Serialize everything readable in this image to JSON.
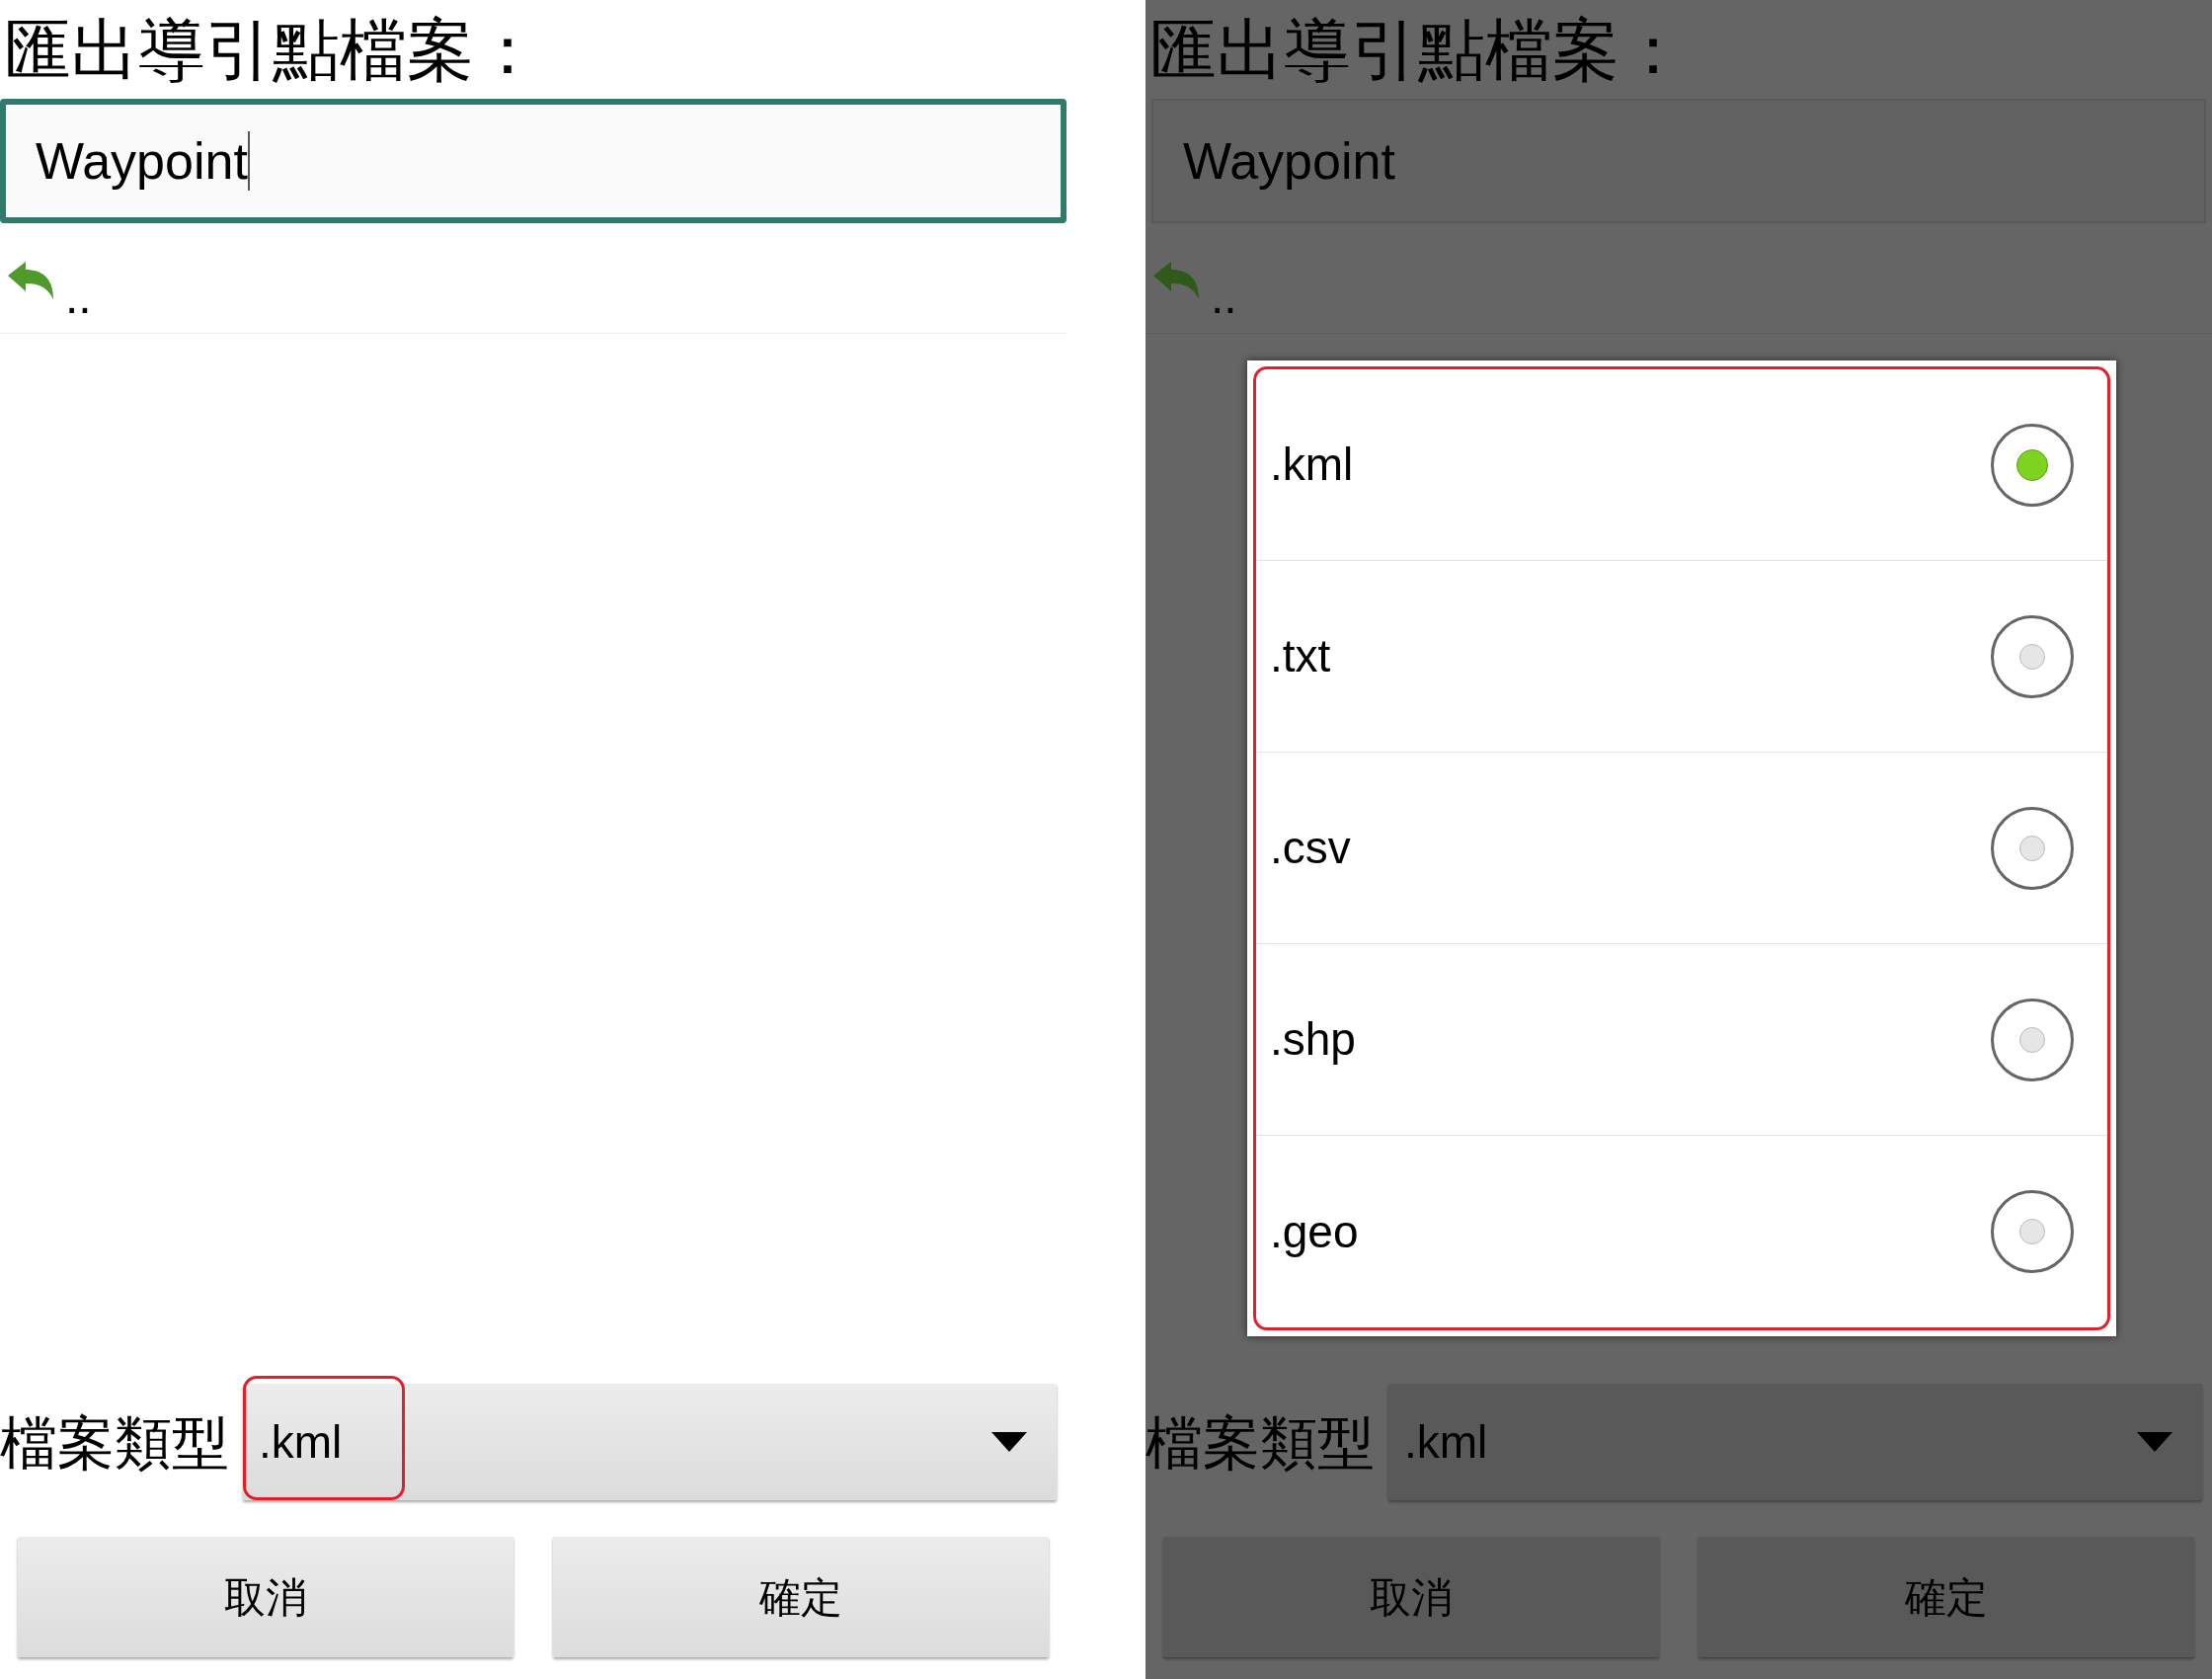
{
  "panels": [
    {
      "dimmed": false,
      "title": "匯出導引點檔案：",
      "filename": {
        "value": "Waypoint",
        "focused": true
      },
      "parent_item": "..",
      "file_type": {
        "label": "檔案類型",
        "value": ".kml"
      },
      "buttons": [
        "取消",
        "確定"
      ]
    },
    {
      "dimmed": true,
      "title": "匯出導引點檔案：",
      "filename": {
        "value": "Waypoint",
        "focused": false
      },
      "parent_item": "..",
      "file_type": {
        "label": "檔案類型",
        "value": ".kml"
      },
      "buttons": [
        "取消",
        "確定"
      ],
      "dialog": {
        "options": [
          {
            "label": ".kml",
            "selected": true
          },
          {
            "label": ".txt",
            "selected": false
          },
          {
            "label": ".csv",
            "selected": false
          },
          {
            "label": ".shp",
            "selected": false
          },
          {
            "label": ".geo",
            "selected": false
          }
        ]
      }
    }
  ]
}
